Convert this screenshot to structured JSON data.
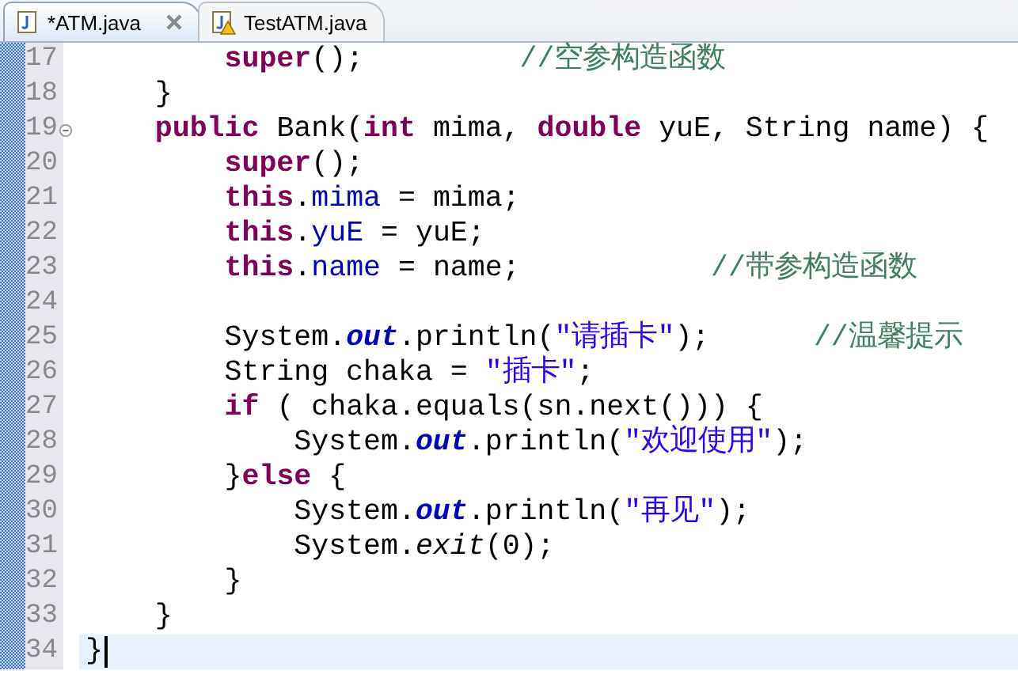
{
  "tabs": [
    {
      "label": "*ATM.java",
      "selected": true,
      "closable": true,
      "warning": false
    },
    {
      "label": "TestATM.java",
      "selected": false,
      "closable": false,
      "warning": true
    }
  ],
  "editor": {
    "lines": [
      {
        "number": "17",
        "fold": false,
        "current": false,
        "tokens": [
          {
            "kind": "keyword",
            "text": "        super"
          },
          {
            "kind": "plain",
            "text": "();"
          },
          {
            "kind": "comment",
            "text": "         //空参构造函数"
          }
        ]
      },
      {
        "number": "18",
        "fold": false,
        "current": false,
        "tokens": [
          {
            "kind": "plain",
            "text": "    }"
          }
        ]
      },
      {
        "number": "19",
        "fold": true,
        "current": false,
        "tokens": [
          {
            "kind": "keyword",
            "text": "    public"
          },
          {
            "kind": "plain",
            "text": " Bank("
          },
          {
            "kind": "keyword",
            "text": "int"
          },
          {
            "kind": "plain",
            "text": " mima, "
          },
          {
            "kind": "keyword",
            "text": "double"
          },
          {
            "kind": "plain",
            "text": " yuE, String name) {"
          }
        ]
      },
      {
        "number": "20",
        "fold": false,
        "current": false,
        "tokens": [
          {
            "kind": "keyword",
            "text": "        super"
          },
          {
            "kind": "plain",
            "text": "();"
          }
        ]
      },
      {
        "number": "21",
        "fold": false,
        "current": false,
        "tokens": [
          {
            "kind": "keyword",
            "text": "        this"
          },
          {
            "kind": "plain",
            "text": "."
          },
          {
            "kind": "field",
            "text": "mima"
          },
          {
            "kind": "plain",
            "text": " = mima;"
          }
        ]
      },
      {
        "number": "22",
        "fold": false,
        "current": false,
        "tokens": [
          {
            "kind": "keyword",
            "text": "        this"
          },
          {
            "kind": "plain",
            "text": "."
          },
          {
            "kind": "field",
            "text": "yuE"
          },
          {
            "kind": "plain",
            "text": " = yuE;"
          }
        ]
      },
      {
        "number": "23",
        "fold": false,
        "current": false,
        "tokens": [
          {
            "kind": "keyword",
            "text": "        this"
          },
          {
            "kind": "plain",
            "text": "."
          },
          {
            "kind": "field",
            "text": "name"
          },
          {
            "kind": "plain",
            "text": " = name;"
          },
          {
            "kind": "comment",
            "text": "           //带参构造函数"
          }
        ]
      },
      {
        "number": "24",
        "fold": false,
        "current": false
      },
      {
        "number": "25",
        "fold": false,
        "current": false,
        "tokens": [
          {
            "kind": "plain",
            "text": "        System."
          },
          {
            "kind": "static",
            "text": "out"
          },
          {
            "kind": "plain",
            "text": ".println("
          },
          {
            "kind": "string",
            "text": "\"请插卡\""
          },
          {
            "kind": "plain",
            "text": ");"
          },
          {
            "kind": "comment",
            "text": "      //温馨提示"
          }
        ]
      },
      {
        "number": "26",
        "fold": false,
        "current": false,
        "tokens": [
          {
            "kind": "plain",
            "text": "        String chaka = "
          },
          {
            "kind": "string",
            "text": "\"插卡\""
          },
          {
            "kind": "plain",
            "text": ";"
          }
        ]
      },
      {
        "number": "27",
        "fold": false,
        "current": false,
        "tokens": [
          {
            "kind": "keyword",
            "text": "        if"
          },
          {
            "kind": "plain",
            "text": " ( chaka.equals(sn.next())) {"
          }
        ]
      },
      {
        "number": "28",
        "fold": false,
        "current": false,
        "tokens": [
          {
            "kind": "plain",
            "text": "            System."
          },
          {
            "kind": "static",
            "text": "out"
          },
          {
            "kind": "plain",
            "text": ".println("
          },
          {
            "kind": "string",
            "text": "\"欢迎使用\""
          },
          {
            "kind": "plain",
            "text": ");"
          }
        ]
      },
      {
        "number": "29",
        "fold": false,
        "current": false,
        "tokens": [
          {
            "kind": "plain",
            "text": "        }"
          },
          {
            "kind": "keyword",
            "text": "else"
          },
          {
            "kind": "plain",
            "text": " {"
          }
        ]
      },
      {
        "number": "30",
        "fold": false,
        "current": false,
        "tokens": [
          {
            "kind": "plain",
            "text": "            System."
          },
          {
            "kind": "static",
            "text": "out"
          },
          {
            "kind": "plain",
            "text": ".println("
          },
          {
            "kind": "string",
            "text": "\"再见\""
          },
          {
            "kind": "plain",
            "text": ");"
          }
        ]
      },
      {
        "number": "31",
        "fold": false,
        "current": false,
        "tokens": [
          {
            "kind": "plain",
            "text": "            System."
          },
          {
            "kind": "static-method",
            "text": "exit"
          },
          {
            "kind": "plain",
            "text": "(0);"
          }
        ]
      },
      {
        "number": "32",
        "fold": false,
        "current": false,
        "tokens": [
          {
            "kind": "plain",
            "text": "        }"
          }
        ]
      },
      {
        "number": "33",
        "fold": false,
        "current": false,
        "tokens": [
          {
            "kind": "plain",
            "text": "    }"
          }
        ]
      },
      {
        "number": "34",
        "fold": false,
        "current": true,
        "tokens": [
          {
            "kind": "plain",
            "text": "}"
          }
        ]
      }
    ]
  }
}
